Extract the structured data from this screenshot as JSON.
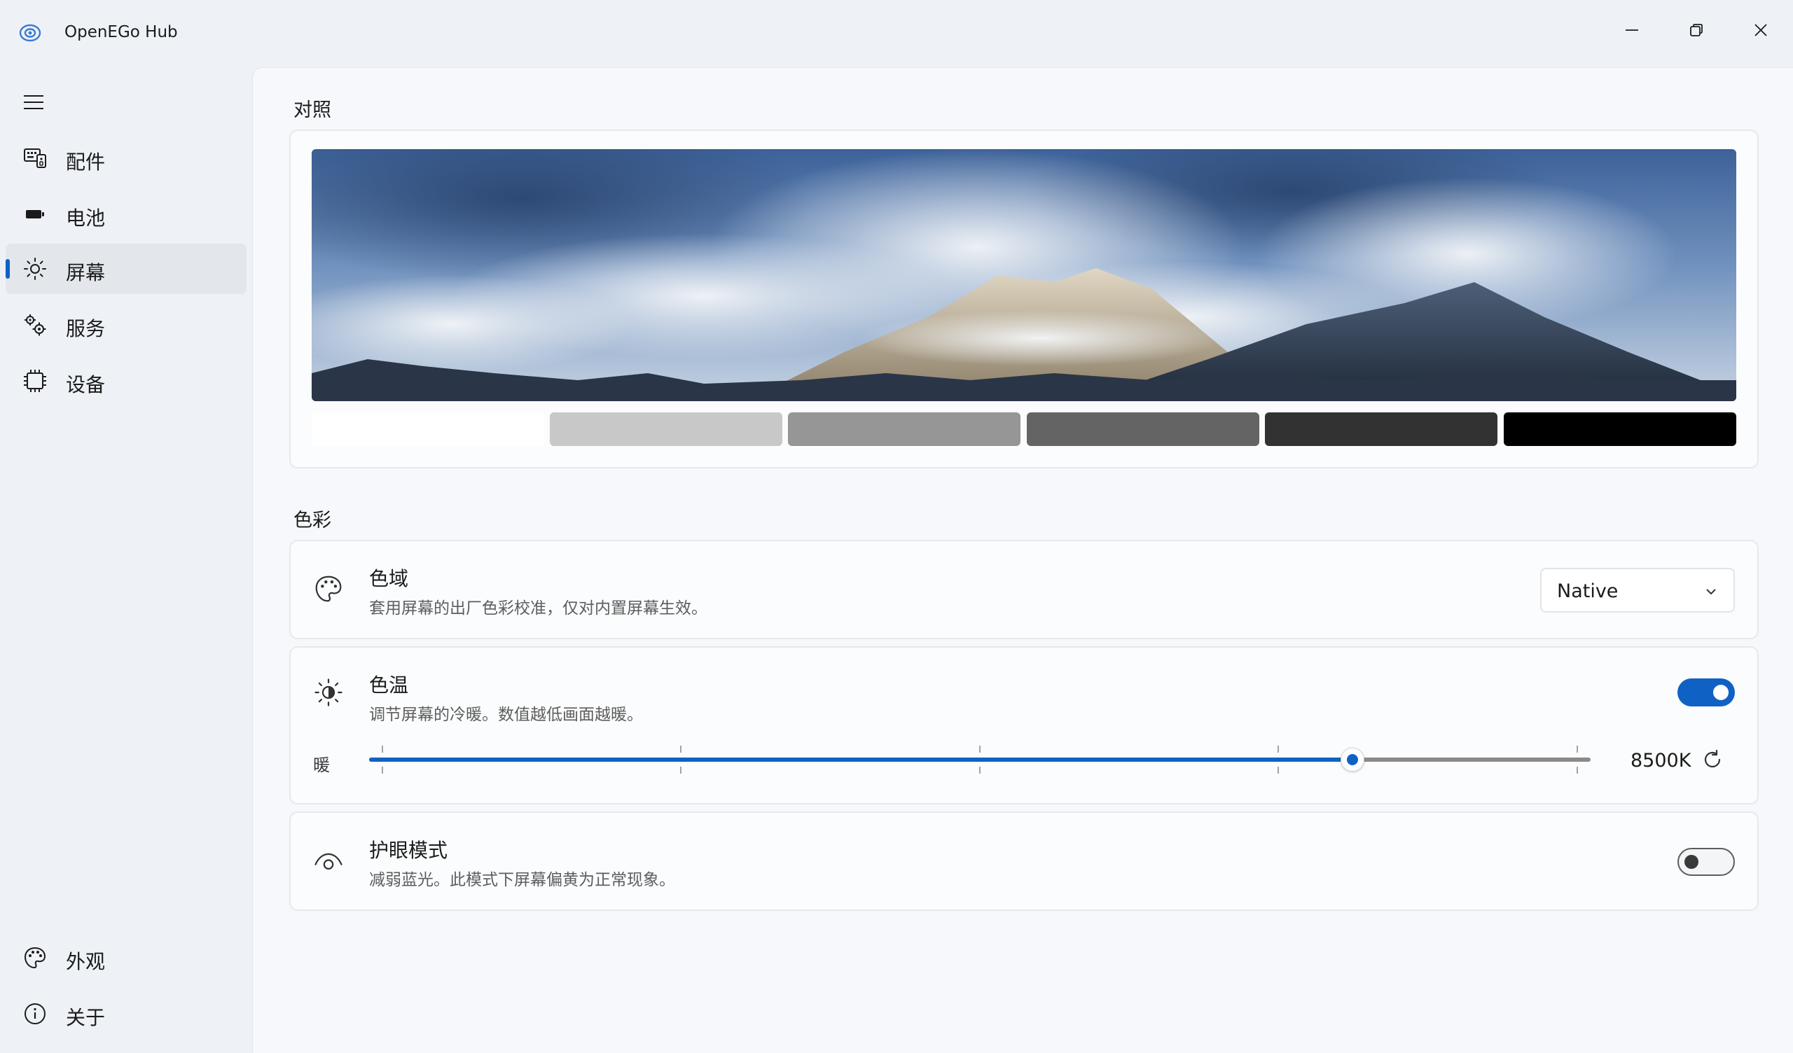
{
  "window": {
    "title": "OpenEGo Hub",
    "icon": "app-logo-icon",
    "controls": [
      "minimize-icon",
      "restore-icon",
      "close-icon"
    ]
  },
  "sidebar": {
    "menu_icon": "hamburger-icon",
    "items": [
      {
        "label": "配件",
        "icon": "keyboard-icon",
        "selected": false
      },
      {
        "label": "电池",
        "icon": "battery-icon",
        "selected": false
      },
      {
        "label": "屏幕",
        "icon": "brightness-icon",
        "selected": true
      },
      {
        "label": "服务",
        "icon": "gears-icon",
        "selected": false
      },
      {
        "label": "设备",
        "icon": "chip-icon",
        "selected": false
      }
    ],
    "footer_items": [
      {
        "label": "外观",
        "icon": "palette-icon"
      },
      {
        "label": "关于",
        "icon": "info-icon"
      }
    ]
  },
  "contrast": {
    "section_title": "对照",
    "swatch_colors": [
      "#ffffff",
      "#c8c8c8",
      "#969696",
      "#646464",
      "#323232",
      "#000000"
    ]
  },
  "color": {
    "section_title": "色彩",
    "gamut": {
      "title": "色域",
      "description": "套用屏幕的出厂色彩校准，仅对内置屏幕生效。",
      "selected": "Native",
      "icon": "palette-icon"
    },
    "temperature": {
      "title": "色温",
      "description": "调节屏幕的冷暖。数值越低画面越暖。",
      "enabled": true,
      "slider_label": "暖",
      "value_text": "8500K",
      "level": 0.805,
      "icon": "brightness-contrast-icon",
      "reset_icon": "refresh-icon"
    },
    "eye_care": {
      "title": "护眼模式",
      "description": "减弱蓝光。此模式下屏幕偏黄为正常现象。",
      "enabled": false,
      "icon": "eye-icon"
    }
  },
  "colors": {
    "accent": "#0f62c4",
    "background": "#eef2f7",
    "panel": "#f6f8fb"
  }
}
